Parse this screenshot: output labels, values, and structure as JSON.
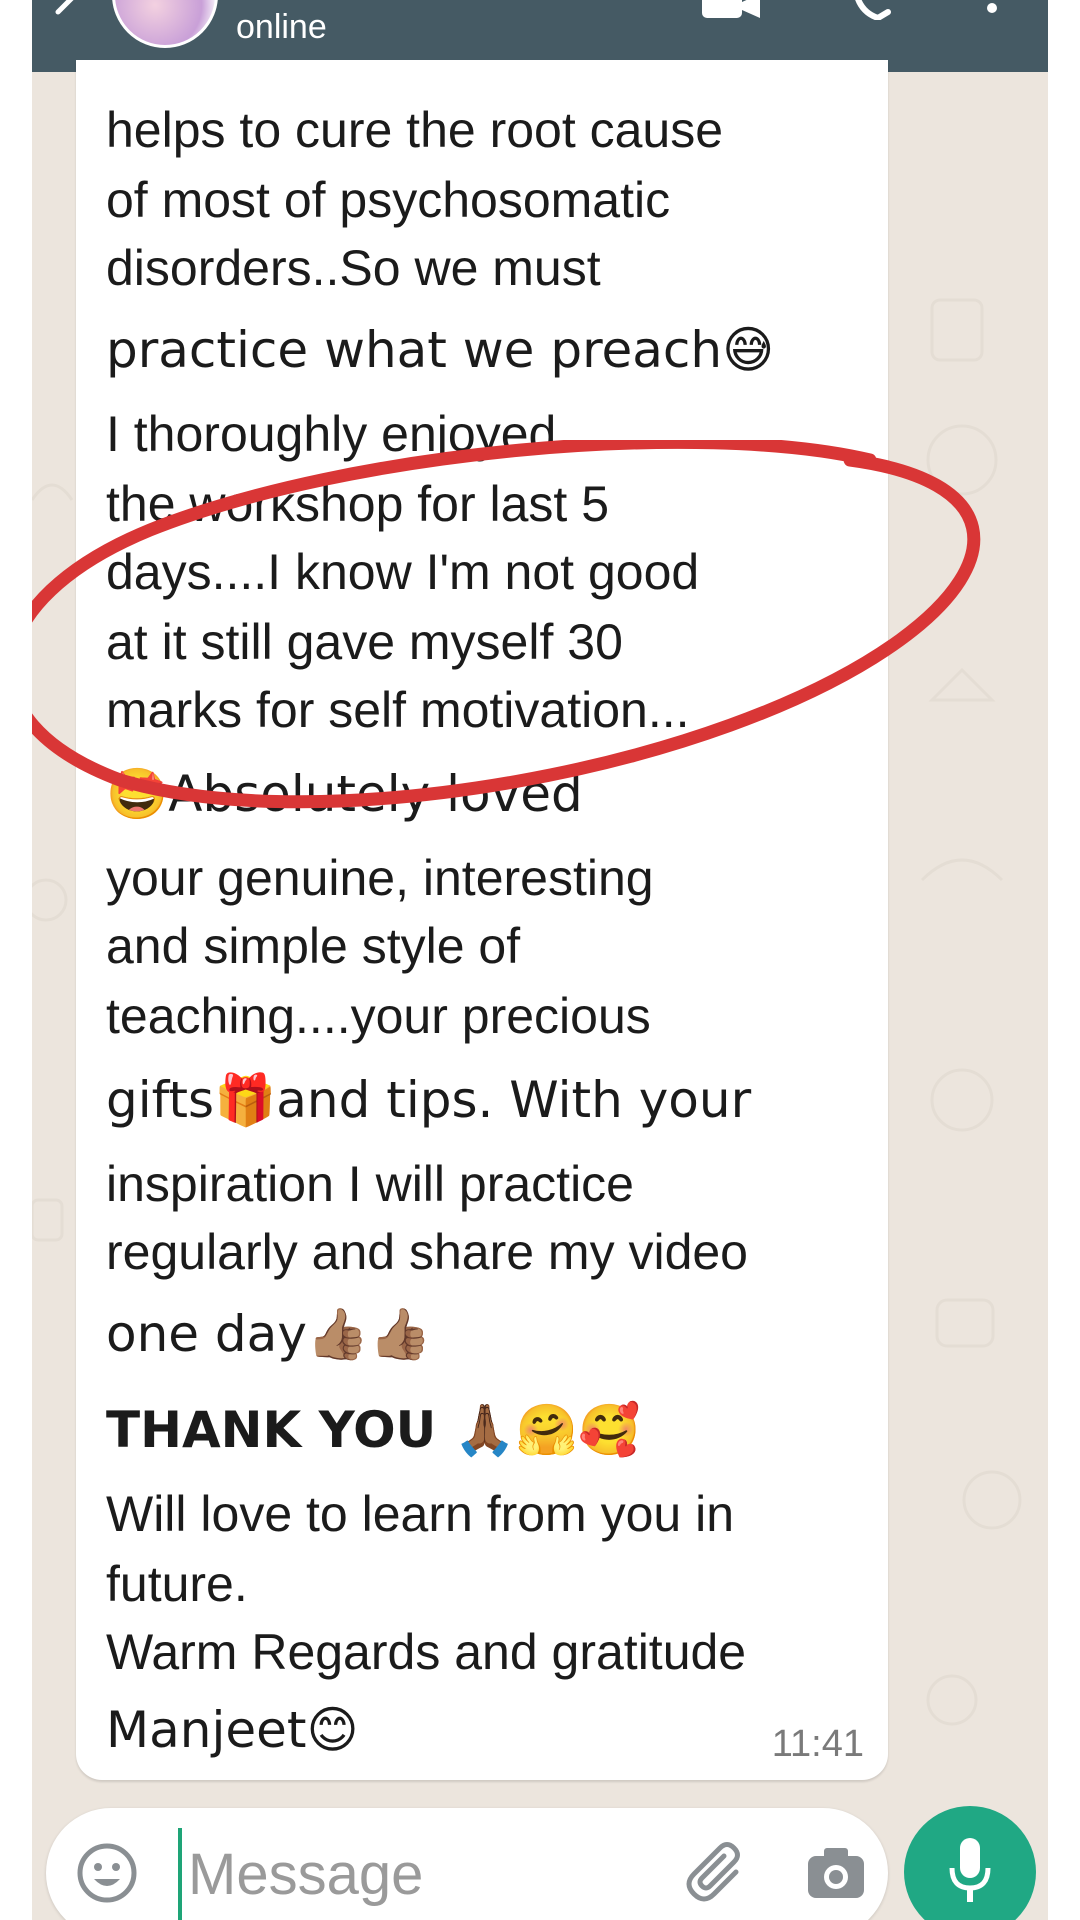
{
  "header": {
    "status": "online",
    "bar_color": "#455a64"
  },
  "message": {
    "lines": [
      "helps to cure the root cause",
      "of most of psychosomatic",
      "disorders..So  we must",
      "practice what we preach😅",
      "I thoroughly enjoyed",
      "the workshop for last 5",
      "days....I know I'm not good",
      "at it still gave myself  30",
      "marks  for self motivation...",
      "🤩Absolutely loved",
      "your  genuine, interesting",
      "and simple style of",
      "teaching....your precious",
      "gifts🎁and tips. With your",
      "inspiration I will practice",
      "regularly and share my video",
      "one day👍🏽👍🏽",
      " THANK YOU  🙏🏾🤗🥰",
      "Will love to learn from you in",
      "future.",
      "Warm Regards and gratitude",
      "Manjeet😊"
    ],
    "time": "11:41",
    "annotation_color": "#d93636"
  },
  "composer": {
    "placeholder": "Message",
    "accent": "#20a884"
  }
}
